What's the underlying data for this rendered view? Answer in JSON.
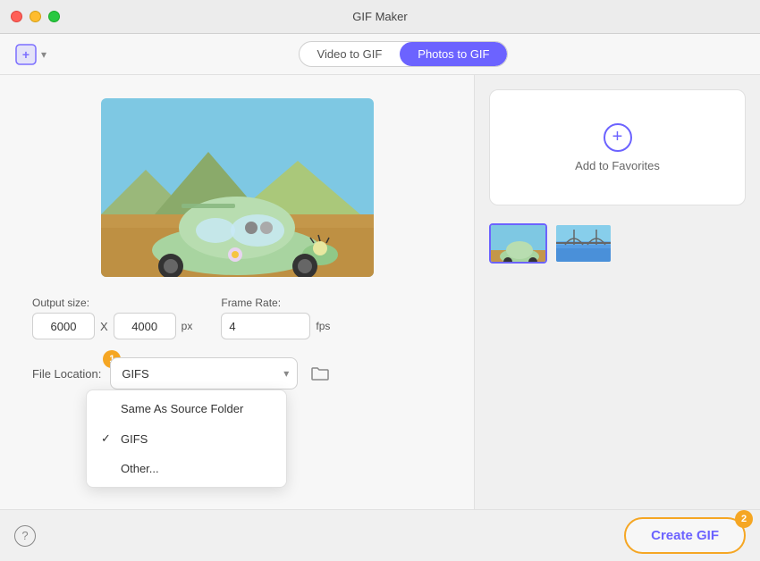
{
  "titleBar": {
    "title": "GIF Maker"
  },
  "toolbar": {
    "importLabel": "＋",
    "modes": [
      {
        "label": "Video to GIF",
        "id": "video-to-gif",
        "active": false
      },
      {
        "label": "Photos to GIF",
        "id": "photos-to-gif",
        "active": true
      }
    ]
  },
  "settings": {
    "outputSizeLabel": "Output size:",
    "widthValue": "6000",
    "heightValue": "4000",
    "pxLabel": "px",
    "xSeparator": "X",
    "frameRateLabel": "Frame Rate:",
    "frameRateValue": "4",
    "fpsLabel": "fps"
  },
  "fileLocation": {
    "label": "File Location:",
    "selectedValue": "GIFS",
    "options": [
      {
        "label": "Same As Source Folder",
        "selected": false
      },
      {
        "label": "GIFS",
        "selected": true
      },
      {
        "label": "Other...",
        "selected": false
      }
    ],
    "checkLabel": "✓"
  },
  "favoritesPanel": {
    "addIcon": "+",
    "addLabel": "Add to Favorites"
  },
  "createGif": {
    "label": "Create GIF"
  },
  "stepBadges": {
    "step1": "1",
    "step2": "2"
  },
  "icons": {
    "importIcon": "📥",
    "folderIcon": "📁",
    "helpIcon": "?"
  }
}
